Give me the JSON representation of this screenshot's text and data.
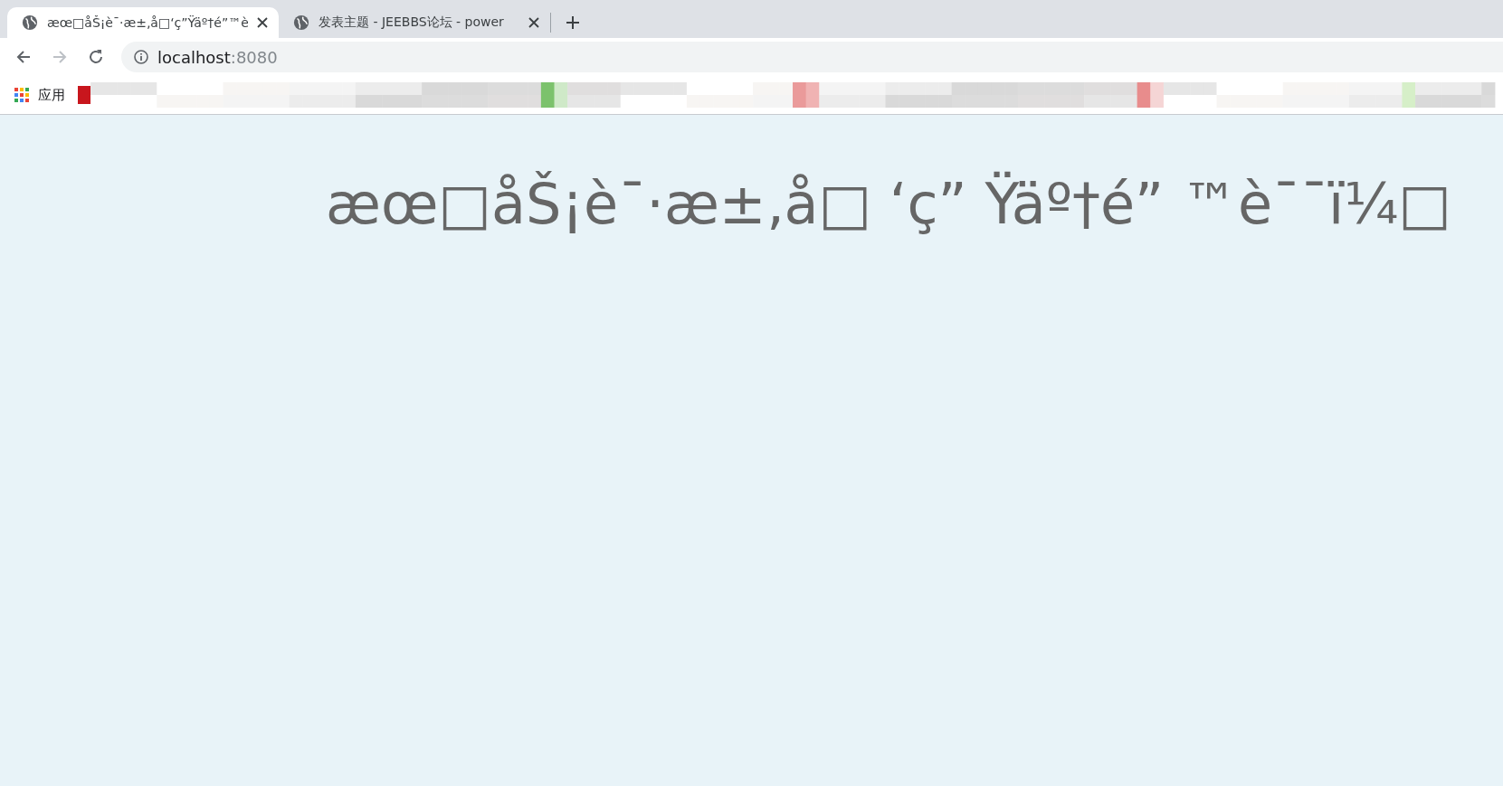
{
  "tabs": [
    {
      "title": "æœ□åŠ¡è¯·æ±‚å□‘ç”Ÿäº†é”™è",
      "selected": true
    },
    {
      "title": "发表主题 - JEEBBS论坛 - power",
      "selected": false
    }
  ],
  "address_bar": {
    "host": "localhost",
    "port": ":8080"
  },
  "bookmarks_bar": {
    "apps_label": "应用"
  },
  "page": {
    "heading": "æœ□åŠ¡è¯·æ±‚å□ ‘ç” Ÿäº†é” ™è¯¯ï¼□"
  }
}
